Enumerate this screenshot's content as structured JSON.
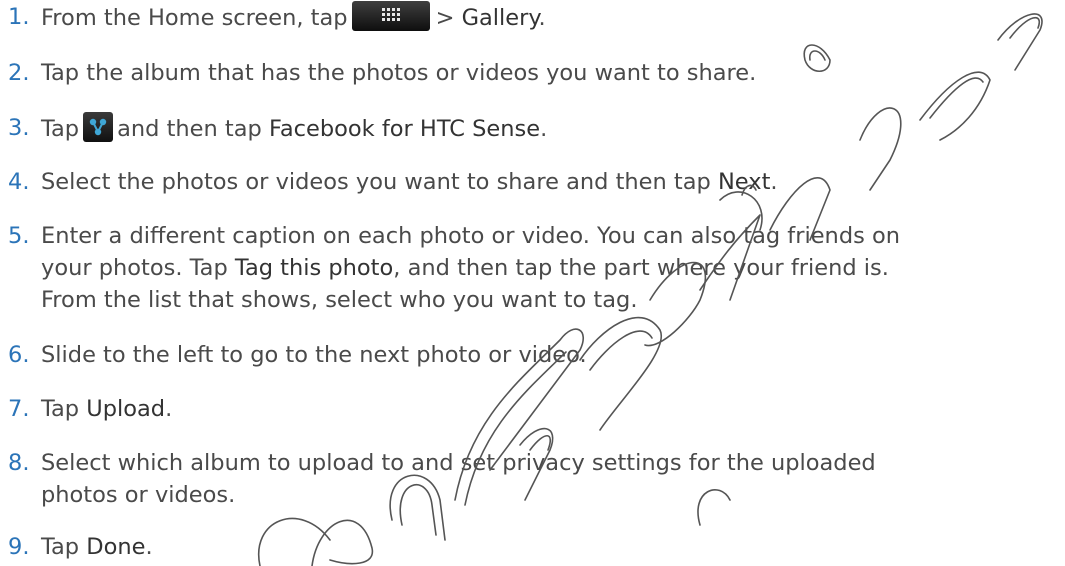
{
  "steps": [
    {
      "num": "1.",
      "a": "From the Home screen, tap",
      "b": "> ",
      "c": "Gallery",
      "d": "."
    },
    {
      "num": "2.",
      "a": "Tap the album that has the photos or videos you want to share."
    },
    {
      "num": "3.",
      "a": "Tap",
      "b": "and then tap ",
      "c": "Facebook for HTC Sense",
      "d": "."
    },
    {
      "num": "4.",
      "a": "Select the photos or videos you want to share and then tap ",
      "c": "Next",
      "d": "."
    },
    {
      "num": "5.",
      "a": "Enter a different caption on each photo or video. You can also tag friends on",
      "line2a": "your photos. Tap ",
      "line2b": "Tag this photo",
      "line2c": ", and then tap the part where your friend is.",
      "line3": "From the list that shows, select who you want to tag."
    },
    {
      "num": "6.",
      "a": "Slide to the left to go to the next photo or video."
    },
    {
      "num": "7.",
      "a": "Tap ",
      "c": "Upload",
      "d": "."
    },
    {
      "num": "8.",
      "a": "Select which album to upload to and set privacy settings for the uploaded",
      "line2": "photos or videos."
    },
    {
      "num": "9.",
      "a": "Tap ",
      "c": "Done",
      "d": "."
    }
  ],
  "icons": {
    "apps": "all-apps-icon",
    "share": "share-icon"
  },
  "watermark": {
    "text": "Confidential",
    "color": "#555555"
  },
  "colors": {
    "step_number": "#2b74b8",
    "body_text": "#4a4a4a"
  }
}
